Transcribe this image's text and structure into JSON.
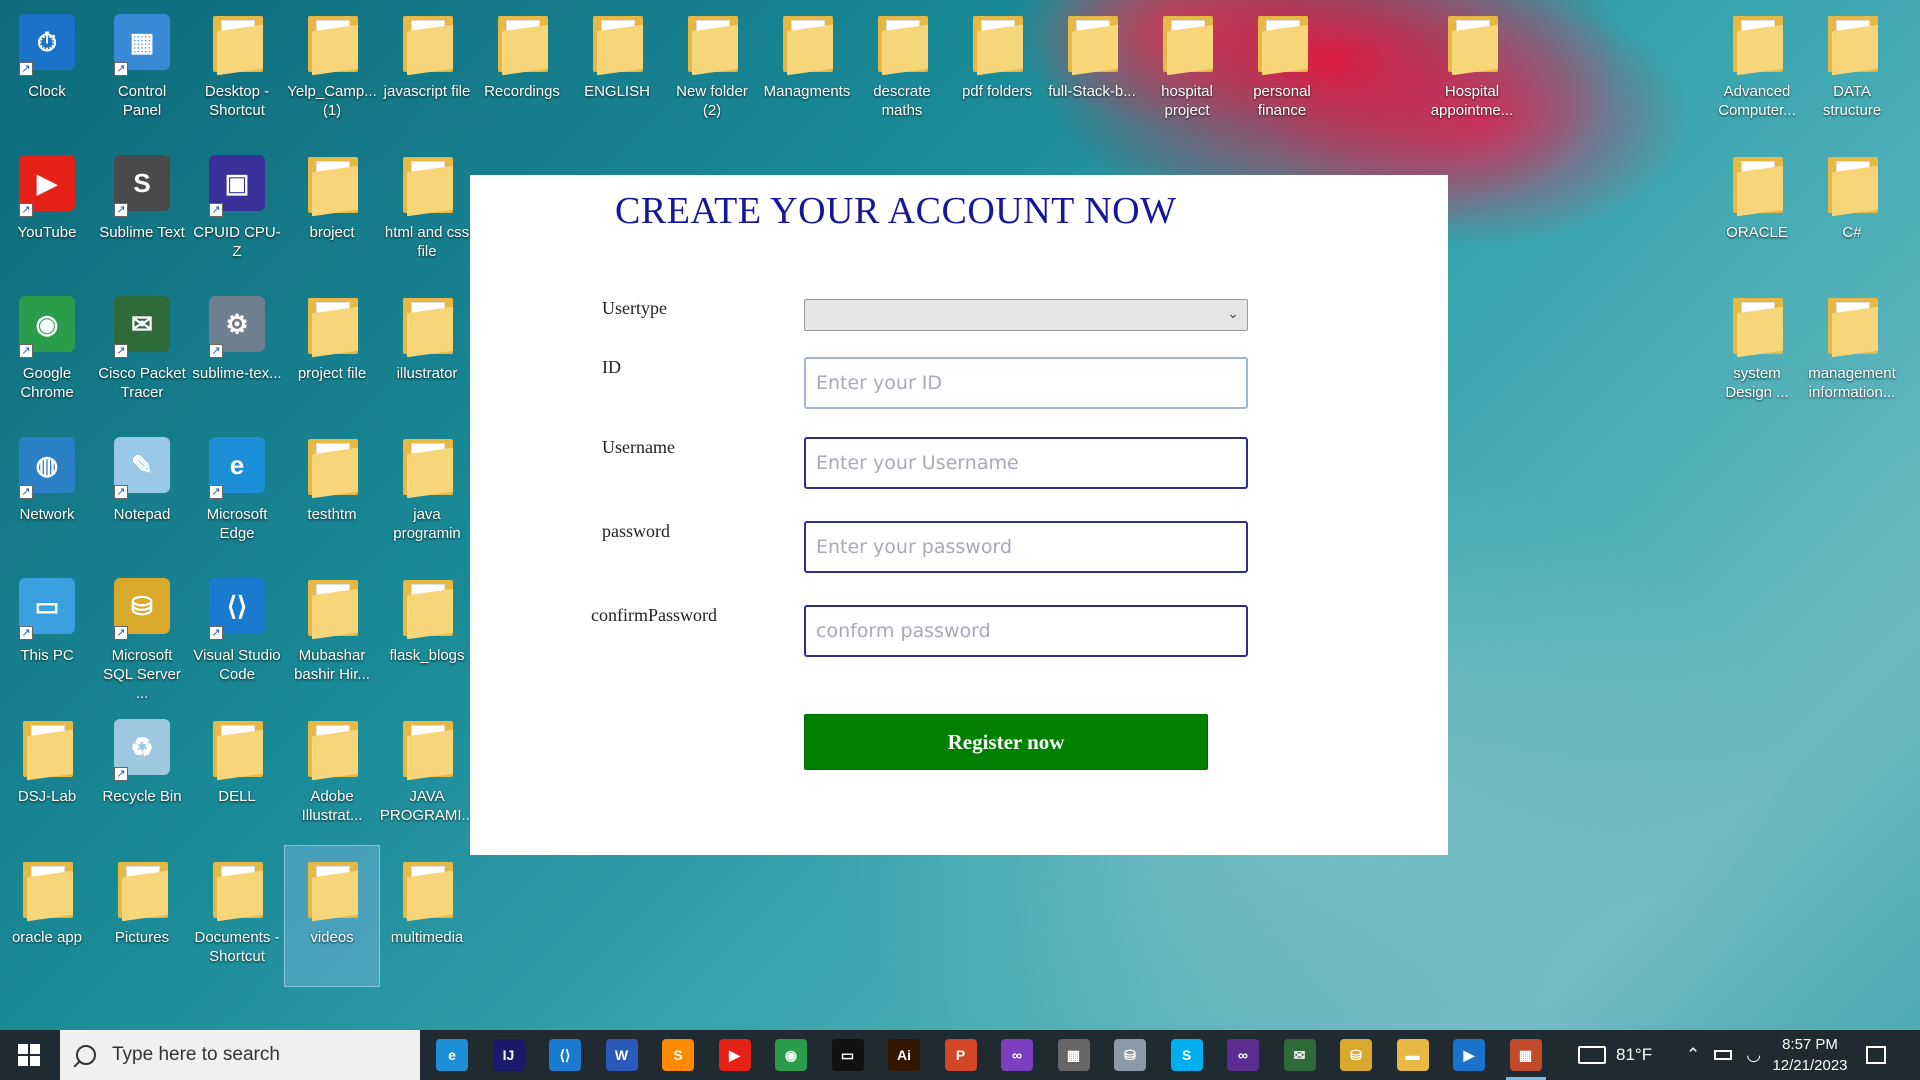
{
  "desktop": {
    "icons": [
      {
        "label": "Clock",
        "icon": "clock-icon"
      },
      {
        "label": "Control Panel",
        "icon": "control-panel-icon"
      },
      {
        "label": "Desktop - Shortcut",
        "icon": "folder-icon"
      },
      {
        "label": "Yelp_Camp... (1)",
        "icon": "folder-icon"
      },
      {
        "label": "javascript file",
        "icon": "folder-icon"
      },
      {
        "label": "Recordings",
        "icon": "folder-icon"
      },
      {
        "label": "ENGLISH",
        "icon": "folder-icon"
      },
      {
        "label": "New folder (2)",
        "icon": "folder-icon"
      },
      {
        "label": "Managments",
        "icon": "folder-icon"
      },
      {
        "label": "descrate maths",
        "icon": "folder-icon"
      },
      {
        "label": "pdf folders",
        "icon": "folder-icon"
      },
      {
        "label": "full-Stack-b...",
        "icon": "folder-icon"
      },
      {
        "label": "hospital project",
        "icon": "folder-icon"
      },
      {
        "label": "personal finance",
        "icon": "folder-icon"
      },
      {
        "label": "Hospital appointme...",
        "icon": "folder-icon"
      },
      {
        "label": "Advanced Computer...",
        "icon": "folder-icon"
      },
      {
        "label": "DATA structure",
        "icon": "folder-icon"
      },
      {
        "label": "YouTube",
        "icon": "youtube-icon"
      },
      {
        "label": "Sublime Text",
        "icon": "sublime-icon"
      },
      {
        "label": "CPUID CPU-Z",
        "icon": "cpuz-icon"
      },
      {
        "label": "broject",
        "icon": "folder-icon"
      },
      {
        "label": "html and css file",
        "icon": "folder-icon"
      },
      {
        "label": "ORACLE",
        "icon": "folder-icon"
      },
      {
        "label": "C#",
        "icon": "folder-icon"
      },
      {
        "label": "Google Chrome",
        "icon": "chrome-icon"
      },
      {
        "label": "Cisco Packet Tracer",
        "icon": "cisco-icon"
      },
      {
        "label": "sublime-tex...",
        "icon": "installer-icon"
      },
      {
        "label": "project file",
        "icon": "folder-icon"
      },
      {
        "label": "illustrator",
        "icon": "folder-icon"
      },
      {
        "label": "system Design ...",
        "icon": "folder-icon"
      },
      {
        "label": "management information...",
        "icon": "folder-icon"
      },
      {
        "label": "Network",
        "icon": "network-icon"
      },
      {
        "label": "Notepad",
        "icon": "notepad-icon"
      },
      {
        "label": "Microsoft Edge",
        "icon": "edge-icon"
      },
      {
        "label": "testhtm",
        "icon": "folder-icon"
      },
      {
        "label": "java programin",
        "icon": "folder-icon"
      },
      {
        "label": "This PC",
        "icon": "pc-icon"
      },
      {
        "label": "Microsoft SQL Server ...",
        "icon": "sql-server-icon"
      },
      {
        "label": "Visual Studio Code",
        "icon": "vscode-icon"
      },
      {
        "label": "Mubashar bashir Hir...",
        "icon": "folder-icon"
      },
      {
        "label": "flask_blogs",
        "icon": "folder-icon"
      },
      {
        "label": "DSJ-Lab",
        "icon": "folder-icon"
      },
      {
        "label": "Recycle Bin",
        "icon": "recycle-bin-icon"
      },
      {
        "label": "DELL",
        "icon": "folder-icon"
      },
      {
        "label": "Adobe Illustrat...",
        "icon": "folder-icon"
      },
      {
        "label": "JAVA PROGRAMI...",
        "icon": "folder-icon"
      },
      {
        "label": "oracle app",
        "icon": "folder-icon"
      },
      {
        "label": "Pictures",
        "icon": "folder-icon"
      },
      {
        "label": "Documents - Shortcut",
        "icon": "folder-icon"
      },
      {
        "label": "videos",
        "icon": "folder-icon"
      },
      {
        "label": "multimedia",
        "icon": "folder-icon"
      }
    ]
  },
  "form": {
    "title": "CREATE YOUR ACCOUNT NOW",
    "usertype_label": "Usertype",
    "usertype_value": "",
    "id_label": "ID",
    "id_placeholder": "Enter your ID",
    "username_label": "Username",
    "username_placeholder": "Enter your Username",
    "password_label": "password",
    "password_placeholder": "Enter your password",
    "confirm_label": "confirmPassword",
    "confirm_placeholder": "conform password",
    "submit_label": "Register now",
    "submit_color": "#018001",
    "title_color": "#16169a"
  },
  "taskbar": {
    "search_placeholder": "Type here to search",
    "apps": [
      "edge-icon",
      "intellij-icon",
      "vscode-icon",
      "word-icon",
      "sublime-icon",
      "youtube-icon",
      "chrome-icon",
      "terminal-icon",
      "illustrator-icon",
      "powerpoint-icon",
      "visual-studio-icon",
      "calculator-icon",
      "drive-icon",
      "skype-icon",
      "visual-studio-2-icon",
      "cisco-icon",
      "sql-server-icon",
      "file-explorer-icon",
      "media-player-icon",
      "control-panel-icon"
    ],
    "weather": "81°F",
    "time": "8:57 PM",
    "date": "12/21/2023"
  }
}
